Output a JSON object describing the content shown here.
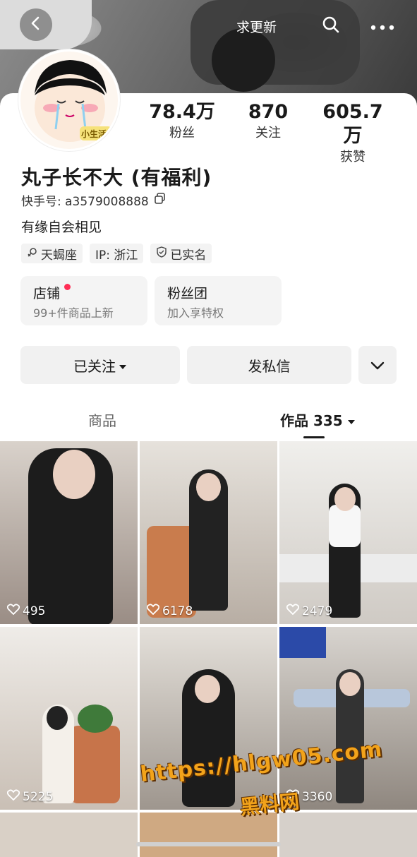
{
  "header": {
    "update_label": "求更新"
  },
  "stats": [
    {
      "value": "78.4万",
      "label": "粉丝"
    },
    {
      "value": "870",
      "label": "关注"
    },
    {
      "value": "605.7万",
      "label": "获赞"
    }
  ],
  "profile": {
    "name": "丸子长不大 (有福利)",
    "kuaishou_id": "快手号: a3579008888",
    "bio": "有缘自会相见",
    "tags": [
      {
        "icon": "scorpio-icon",
        "label": "天蝎座"
      },
      {
        "icon": "",
        "label": "IP: 浙江"
      },
      {
        "icon": "verified-shield-icon",
        "label": "已实名"
      }
    ],
    "avatar_sticker_text": "小生活"
  },
  "cards": [
    {
      "title": "店铺",
      "subtitle": "99+件商品上新"
    },
    {
      "title": "粉丝团",
      "subtitle": "加入享特权"
    }
  ],
  "actions": {
    "followed": "已关注",
    "message": "发私信"
  },
  "tabs": {
    "products": "商品",
    "works": "作品 335"
  },
  "videos": [
    {
      "likes": "495"
    },
    {
      "likes": "6178"
    },
    {
      "likes": "2479"
    },
    {
      "likes": "5225"
    },
    {
      "likes": ""
    },
    {
      "likes": "3360"
    }
  ],
  "watermark": {
    "url": "https://hlgw05.com",
    "brand": "黑料网"
  },
  "colors": {
    "accent_dot": "#ff2d55",
    "watermark": "#f2a31b"
  }
}
